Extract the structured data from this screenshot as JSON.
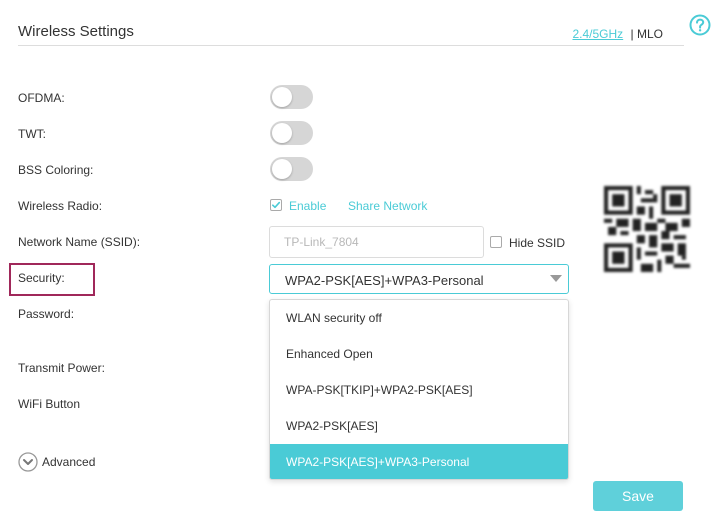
{
  "header": {
    "title": "Wireless Settings",
    "band_link": "2.4/5GHz",
    "mlo_label": "MLO",
    "help_icon": "question-circle-icon"
  },
  "settings": {
    "ofdma_label": "OFDMA:",
    "ofdma_on": false,
    "twt_label": "TWT:",
    "twt_on": false,
    "bss_label": "BSS Coloring:",
    "bss_on": false,
    "radio_label": "Wireless Radio:",
    "enable_label": "Enable",
    "enable_checked": true,
    "share_network": "Share Network",
    "ssid_label": "Network Name (SSID):",
    "ssid_value": "TP-Link_7804",
    "hide_ssid_label": "Hide SSID",
    "hide_ssid_checked": false,
    "security_label": "Security:",
    "security_value": "WPA2-PSK[AES]+WPA3-Personal",
    "password_label": "Password:",
    "transmit_power_label": "Transmit Power:",
    "wifi_button_label": "WiFi Button"
  },
  "security_options": [
    "WLAN security off",
    "Enhanced Open",
    "WPA-PSK[TKIP]+WPA2-PSK[AES]",
    "WPA2-PSK[AES]",
    "WPA2-PSK[AES]+WPA3-Personal"
  ],
  "selected_option_index": 4,
  "advanced": {
    "label": "Advanced",
    "icon": "chevron-down-circle-icon"
  },
  "actions": {
    "save_label": "Save"
  },
  "colors": {
    "accent": "#4acbd6",
    "toggle_off": "#d6d6d6",
    "highlight_box": "#a0285a",
    "save_button": "#5fd0da"
  }
}
